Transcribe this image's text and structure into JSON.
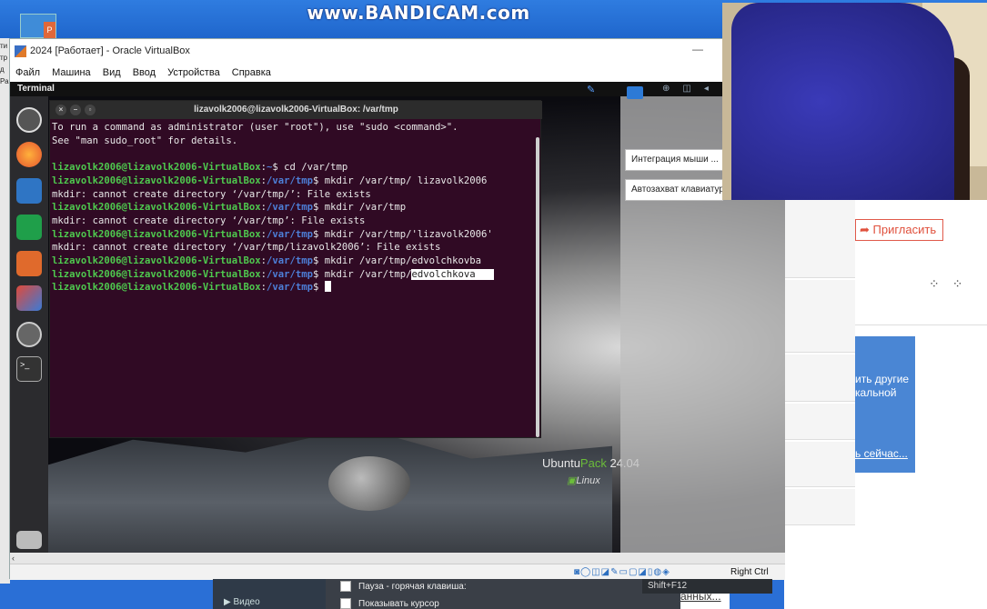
{
  "watermark": "www.BANDICAM.com",
  "window": {
    "title": "2024 [Работает] - Oracle VirtualBox",
    "menu": [
      "Файл",
      "Машина",
      "Вид",
      "Ввод",
      "Устройства",
      "Справка"
    ]
  },
  "guest": {
    "app_name": "Terminal",
    "terminal_title": "lizavolk2006@lizavolk2006-VirtualBox: /var/tmp",
    "user_host": "lizavolk2006@lizavolk2006-VirtualBox",
    "path": "/var/tmp",
    "intro": [
      "To run a command as administrator (user \"root\"), use \"sudo <command>\".",
      "See \"man sudo_root\" for details."
    ],
    "commands": [
      {
        "path": "~",
        "cmd": "$ cd /var/tmp"
      },
      {
        "path": "/var/tmp",
        "cmd": "$ mkdir /var/tmp/ lizavolk2006"
      },
      {
        "output": "mkdir: cannot create directory ‘/var/tmp/’: File exists"
      },
      {
        "path": "/var/tmp",
        "cmd": "$ mkdir /var/tmp"
      },
      {
        "output": "mkdir: cannot create directory ‘/var/tmp’: File exists"
      },
      {
        "path": "/var/tmp",
        "cmd": "$ mkdir /var/tmp/'lizavolk2006'"
      },
      {
        "output": "mkdir: cannot create directory ‘/var/tmp/lizavolk2006’: File exists"
      },
      {
        "path": "/var/tmp",
        "cmd": "$ mkdir /var/tmp/edvolchkovba"
      },
      {
        "path": "/var/tmp",
        "cmd": "$ mkdir /var/tmp/",
        "selected": "edvolchkova"
      },
      {
        "path": "/var/tmp",
        "cmd": "$ ",
        "cursor": true
      }
    ],
    "wallpaper_brand": {
      "ubuntu": "Ubuntu",
      "pack": "Pack",
      "version": "24.04",
      "linux": "Linux"
    },
    "notifications": [
      "Интеграция мыши ...",
      "Автозахват клавиатуры"
    ]
  },
  "host_right": {
    "invite": "Пригласить",
    "card_line1": "ить другие",
    "card_line2": "кальной",
    "card_link": "ь сейчас..."
  },
  "statusbar": {
    "host_key": "Right Ctrl"
  },
  "dialog": {
    "section": "Видео",
    "pause_label": "Пауза - горячая клавиша:",
    "pause_key": "Shift+F12",
    "show_cursor_label": "Показывать курсор",
    "link": "анных..."
  },
  "colors": {
    "terminal_bg": "#300a24",
    "prompt_user": "#4ec94e",
    "prompt_path": "#4d7fd8",
    "host_bg": "#2a6fd6"
  }
}
